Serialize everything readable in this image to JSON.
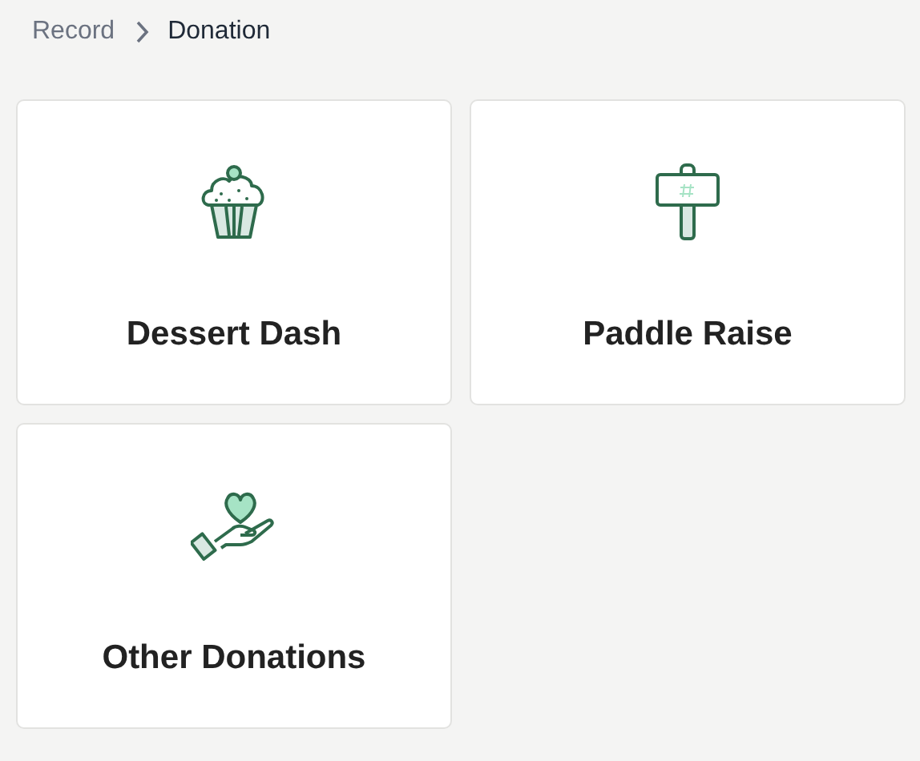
{
  "breadcrumb": [
    {
      "label": "Record",
      "current": false
    },
    {
      "label": "Donation",
      "current": true
    }
  ],
  "cards": [
    {
      "kind": "cupcake",
      "label": "Dessert Dash"
    },
    {
      "kind": "paddle",
      "label": "Paddle Raise"
    },
    {
      "kind": "hand-heart",
      "label": "Other Donations"
    }
  ]
}
